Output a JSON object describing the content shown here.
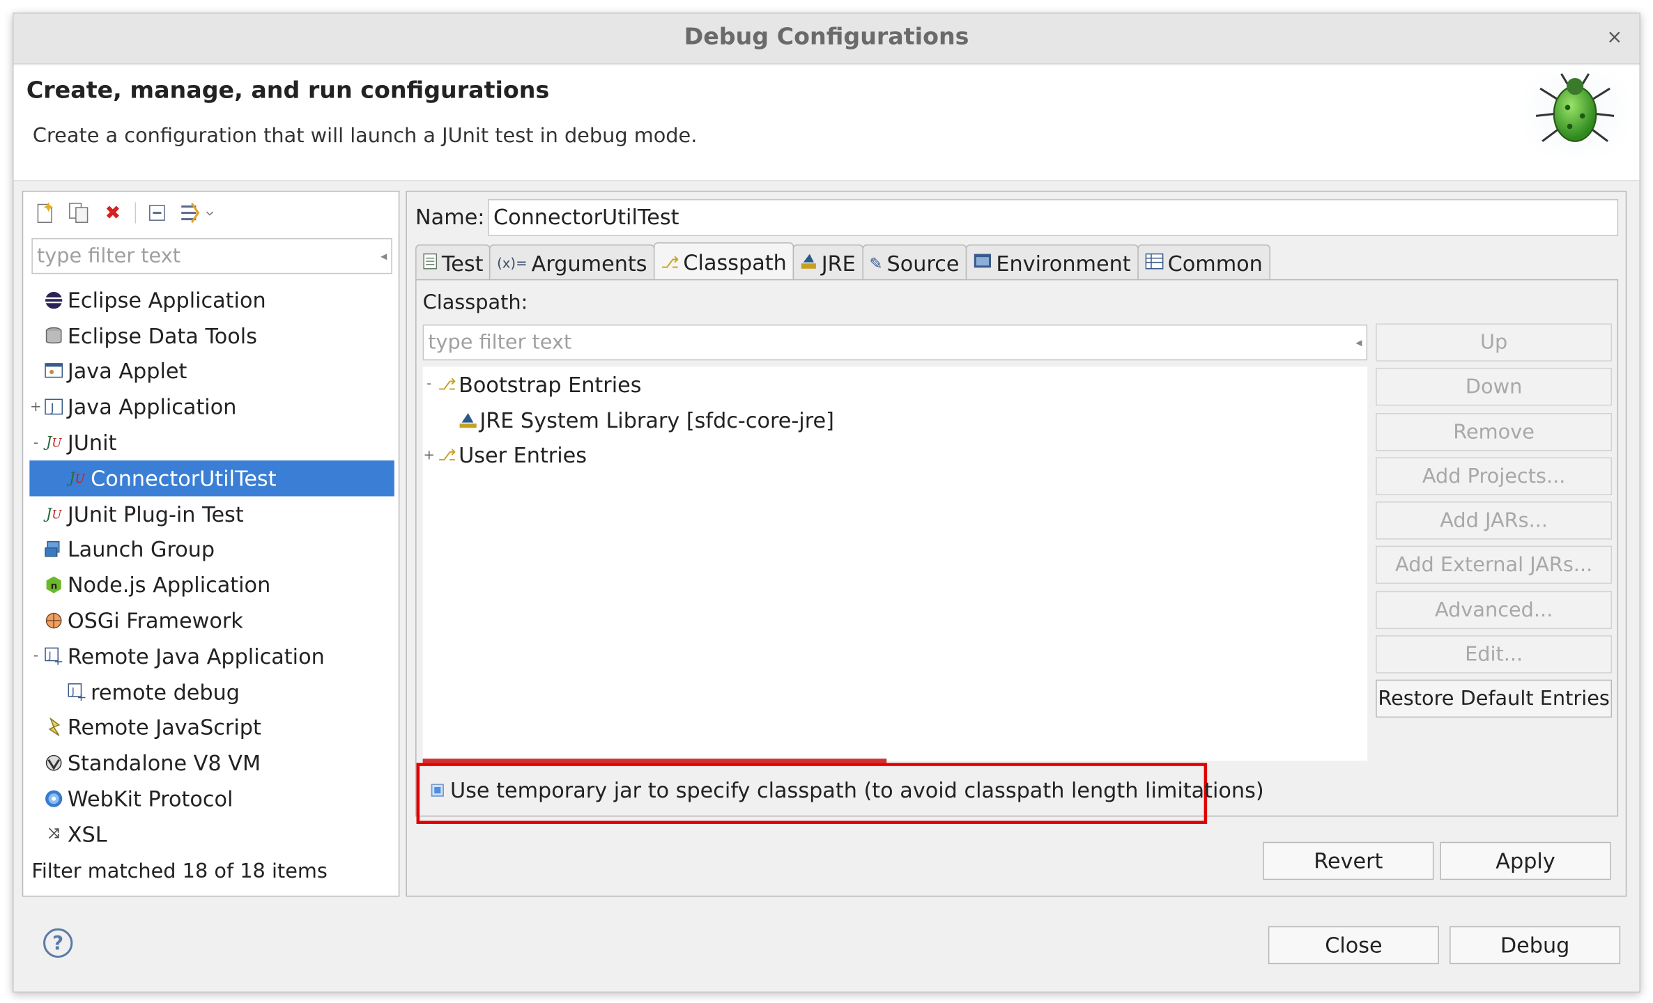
{
  "window": {
    "title": "Debug Configurations",
    "close_label": "×"
  },
  "banner": {
    "title": "Create, manage, and run configurations",
    "description": "Create a configuration that will launch a JUnit test in debug mode."
  },
  "left": {
    "filter_placeholder": "type filter text",
    "items": [
      {
        "label": "Eclipse Application",
        "icon": "eclipse-icon"
      },
      {
        "label": "Eclipse Data Tools",
        "icon": "database-icon"
      },
      {
        "label": "Java Applet",
        "icon": "applet-icon"
      },
      {
        "label": "Java Application",
        "icon": "java-app-icon",
        "expander": "+"
      },
      {
        "label": "JUnit",
        "icon": "junit-icon",
        "expander": "-"
      },
      {
        "label": "ConnectorUtilTest",
        "icon": "junit-icon",
        "selected": true,
        "child": true
      },
      {
        "label": "JUnit Plug-in Test",
        "icon": "junit-plugin-icon"
      },
      {
        "label": "Launch Group",
        "icon": "launch-group-icon"
      },
      {
        "label": "Node.js Application",
        "icon": "nodejs-icon"
      },
      {
        "label": "OSGi Framework",
        "icon": "osgi-icon"
      },
      {
        "label": "Remote Java Application",
        "icon": "remote-java-icon",
        "expander": "-"
      },
      {
        "label": "remote debug",
        "icon": "remote-java-icon",
        "child": true
      },
      {
        "label": "Remote JavaScript",
        "icon": "remote-js-icon"
      },
      {
        "label": "Standalone V8 VM",
        "icon": "v8-icon"
      },
      {
        "label": "WebKit Protocol",
        "icon": "webkit-icon"
      },
      {
        "label": "XSL",
        "icon": "xsl-icon"
      }
    ],
    "status": "Filter matched 18 of 18 items"
  },
  "right": {
    "name_label": "Name:",
    "name_value": "ConnectorUtilTest",
    "tabs": [
      {
        "label": "Test",
        "icon": "test-tab-icon"
      },
      {
        "label": "Arguments",
        "icon": "arguments-icon"
      },
      {
        "label": "Classpath",
        "icon": "classpath-icon",
        "active": true
      },
      {
        "label": "JRE",
        "icon": "jre-icon"
      },
      {
        "label": "Source",
        "icon": "source-icon"
      },
      {
        "label": "Environment",
        "icon": "environment-icon"
      },
      {
        "label": "Common",
        "icon": "common-icon"
      }
    ],
    "classpath_label": "Classpath:",
    "cp_filter_placeholder": "type filter text",
    "cp_entries": [
      {
        "label": "Bootstrap Entries",
        "expander": "-",
        "icon": "entries-icon"
      },
      {
        "label": "JRE System Library [sfdc-core-jre]",
        "child": true,
        "icon": "library-icon"
      },
      {
        "label": "User Entries",
        "expander": "+",
        "icon": "entries-icon"
      }
    ],
    "side_buttons": [
      {
        "label": "Up"
      },
      {
        "label": "Down"
      },
      {
        "label": "Remove"
      },
      {
        "label": "Add Projects..."
      },
      {
        "label": "Add JARs..."
      },
      {
        "label": "Add External JARs..."
      },
      {
        "label": "Advanced..."
      },
      {
        "label": "Edit..."
      },
      {
        "label": "Restore Default Entries",
        "enabled": true
      }
    ],
    "checkbox_label": "Use temporary jar to specify classpath (to avoid classpath length limitations)",
    "checkbox_checked": true,
    "revert_label": "Revert",
    "apply_label": "Apply"
  },
  "footer": {
    "help_label": "?",
    "close_label": "Close",
    "debug_label": "Debug"
  },
  "colors": {
    "selection": "#3a7fd5",
    "highlight_border": "#e00000"
  }
}
